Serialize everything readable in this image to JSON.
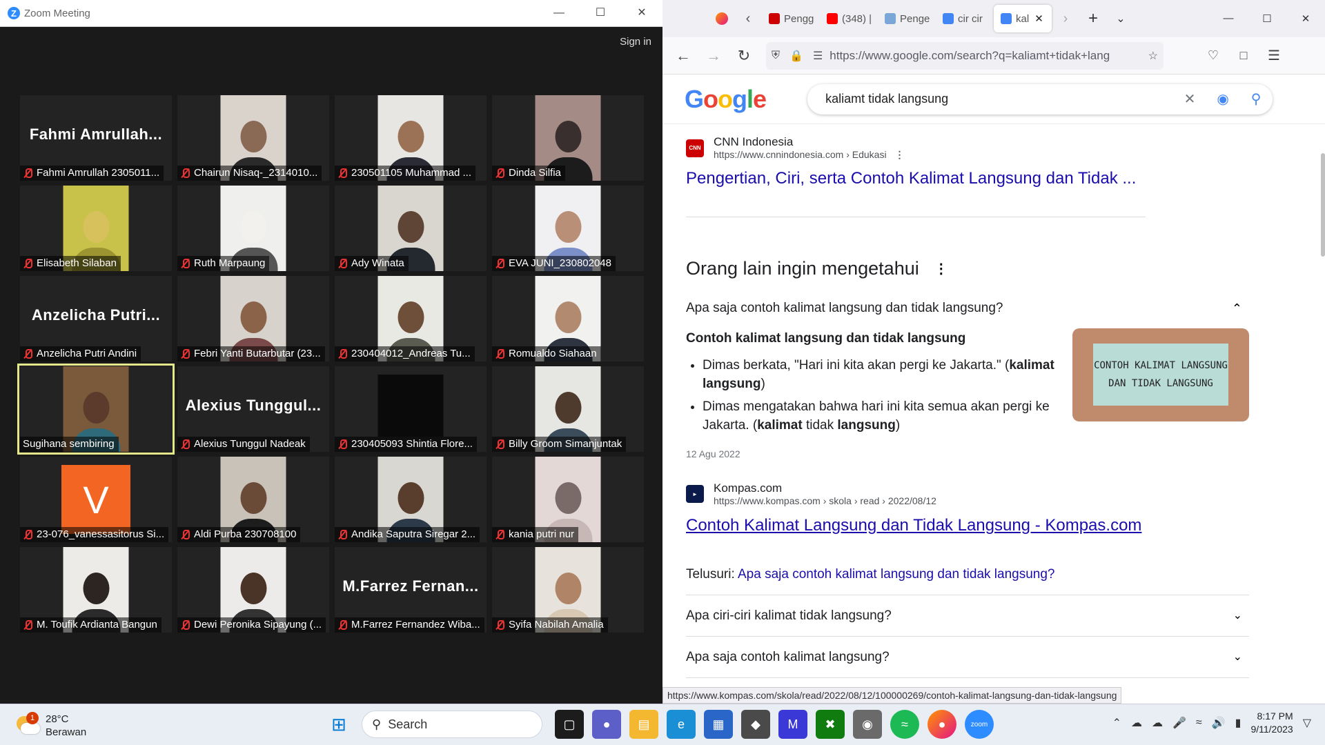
{
  "zoom": {
    "window_title": "Zoom Meeting",
    "sign_in": "Sign in",
    "participants": [
      {
        "name": "Fahmi Amrullah 2305011...",
        "big": "Fahmi  Amrullah...",
        "type": "name",
        "muted": true
      },
      {
        "name": "Chairun Nisaq-_2314010...",
        "type": "video",
        "bg": "#d9d3cc",
        "skin": "#8a6a55",
        "cloth": "#2a2a2a",
        "muted": true
      },
      {
        "name": "230501105 Muhammad ...",
        "type": "video",
        "bg": "#e8e6e2",
        "skin": "#9c7257",
        "cloth": "#2b2b36",
        "muted": true
      },
      {
        "name": "Dinda Silfia",
        "type": "video",
        "bg": "#a58b86",
        "skin": "#3a2f2f",
        "cloth": "#1c1c1c",
        "muted": true
      },
      {
        "name": "Elisabeth Silaban",
        "type": "video",
        "bg": "#c8c24a",
        "skin": "#d6c15c",
        "cloth": "#9c9430",
        "muted": true
      },
      {
        "name": "Ruth Marpaung",
        "type": "video",
        "bg": "#efefed",
        "skin": "#f2f1ee",
        "cloth": "#555",
        "muted": true
      },
      {
        "name": "Ady Winata",
        "type": "video",
        "bg": "#d9d6cf",
        "skin": "#5f4535",
        "cloth": "#24282f",
        "muted": true
      },
      {
        "name": "EVA JUNI_230802048",
        "type": "video",
        "bg": "#f0f0f2",
        "skin": "#b98f77",
        "cloth": "#7b8fc9",
        "muted": true
      },
      {
        "name": "Anzelicha Putri Andini",
        "big": "Anzelicha  Putri...",
        "type": "name",
        "muted": true
      },
      {
        "name": "Febri Yanti Butarbutar (23...",
        "type": "video",
        "bg": "#d7d2cb",
        "skin": "#8b6348",
        "cloth": "#7a4a4a",
        "muted": true
      },
      {
        "name": "230404012_Andreas Tu...",
        "type": "video",
        "bg": "#e9e9e4",
        "skin": "#6e4f3a",
        "cloth": "#5a5c52",
        "muted": true
      },
      {
        "name": "Romualdo Siahaan",
        "type": "video",
        "bg": "#f1f1ef",
        "skin": "#b18a70",
        "cloth": "#2e3440",
        "muted": true
      },
      {
        "name": "Sugihana sembiring",
        "type": "video",
        "bg": "#7a5a3a",
        "skin": "#5c3b2c",
        "cloth": "#2f6a7a",
        "muted": false,
        "active": true
      },
      {
        "name": "Alexius Tunggul Nadeak",
        "big": "Alexius  Tunggul...",
        "type": "name",
        "muted": true
      },
      {
        "name": "230405093 Shintia Flore...",
        "type": "black",
        "muted": true
      },
      {
        "name": "Billy Groom Simanjuntak",
        "type": "video",
        "bg": "#e6e7e3",
        "skin": "#4f3a2e",
        "cloth": "#3b4c5a",
        "muted": true
      },
      {
        "name": "23-076_vanessasitorus Si...",
        "type": "avatar",
        "initial": "V",
        "muted": true
      },
      {
        "name": "Aldi Purba 230708100",
        "type": "video",
        "bg": "#c9c2b8",
        "skin": "#6a4b38",
        "cloth": "#1d1d1d",
        "muted": true
      },
      {
        "name": "Andika Saputra Siregar 2...",
        "type": "video",
        "bg": "#d8d7d2",
        "skin": "#5a3e2d",
        "cloth": "#2d3a4a",
        "muted": true
      },
      {
        "name": "kania putri nur",
        "type": "video",
        "bg": "#e4d8d6",
        "skin": "#7a6a68",
        "cloth": "#c8b8b5",
        "muted": true
      },
      {
        "name": "M. Toufik Ardianta Bangun",
        "type": "video",
        "bg": "#ecebe8",
        "skin": "#2c2522",
        "cloth": "#2b2b2b",
        "muted": true
      },
      {
        "name": "Dewi Peronika Sipayung (...",
        "type": "video",
        "bg": "#ecebea",
        "skin": "#4a3428",
        "cloth": "#333",
        "muted": true
      },
      {
        "name": "M.Farrez Fernandez Wiba...",
        "big": "M.Farrez  Fernan...",
        "type": "name",
        "muted": true
      },
      {
        "name": "Syifa Nabilah Amalia",
        "type": "video",
        "bg": "#e7e3dc",
        "skin": "#b08466",
        "cloth": "#d8c7b3",
        "muted": true
      }
    ]
  },
  "browser": {
    "tabs": [
      {
        "label": "Pengg",
        "color": "#cc0000"
      },
      {
        "label": "(348) |",
        "color": "#ff0000"
      },
      {
        "label": "Penge",
        "color": "#7aa6d8"
      },
      {
        "label": "cir cir",
        "color": "#4285f4"
      },
      {
        "label": "kal",
        "color": "#4285f4",
        "selected": true
      }
    ],
    "url": "https://www.google.com/search?q=kaliamt+tidak+lang",
    "status_url": "https://www.kompas.com/skola/read/2022/08/12/100000269/contoh-kalimat-langsung-dan-tidak-langsung"
  },
  "google": {
    "logo": "Google",
    "query": "kaliamt tidak langsung",
    "result1": {
      "source": "CNN Indonesia",
      "url": "https://www.cnnindonesia.com › Edukasi",
      "title": "Pengertian, Ciri, serta Contoh Kalimat Langsung dan Tidak ...",
      "icon_text": "CNN"
    },
    "paa": {
      "heading": "Orang lain ingin mengetahui",
      "q1": "Apa saja contoh kalimat langsung dan tidak langsung?",
      "answer_heading": "Contoh kalimat langsung dan tidak langsung",
      "bullet1_a": "Dimas berkata, \"Hari ini kita akan pergi ke Jakarta.\" (",
      "bullet1_b": "kalimat langsung",
      "bullet1_c": ")",
      "bullet2_a": "Dimas mengatakan bahwa hari ini kita semua akan pergi ke Jakarta. (",
      "bullet2_b": "kalimat",
      "bullet2_c": " tidak ",
      "bullet2_d": "langsung",
      "bullet2_e": ")",
      "date": "12 Agu 2022",
      "thumb_text": "CONTOH KALIMAT LANGSUNG DAN TIDAK LANGSUNG",
      "source": "Kompas.com",
      "source_url": "https://www.kompas.com › skola › read › 2022/08/12",
      "link": "Contoh Kalimat Langsung dan Tidak Langsung - Kompas.com",
      "telusuri_label": "Telusuri:",
      "telusuri_link": "Apa saja contoh kalimat langsung dan tidak langsung?",
      "q2": "Apa ciri-ciri kalimat tidak langsung?",
      "q3": "Apa saja contoh kalimat langsung?"
    }
  },
  "taskbar": {
    "temp": "28°C",
    "weather": "Berawan",
    "badge": "1",
    "search": "Search",
    "time": "8:17 PM",
    "date": "9/11/2023"
  }
}
